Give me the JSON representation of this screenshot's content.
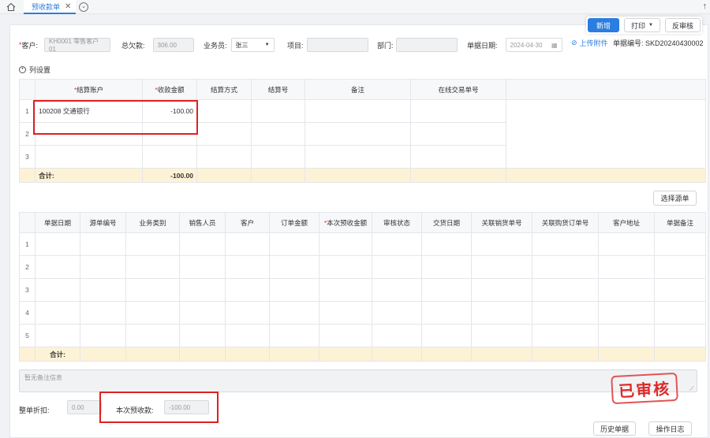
{
  "tabs": {
    "active": "预收款单",
    "close": "✕"
  },
  "toolbar": {
    "new": "新增",
    "print": "打印",
    "unaudit": "反审核"
  },
  "form": {
    "customer_label": "客户:",
    "customer_value": "KH0001 零售客户01",
    "debt_label": "总欠款:",
    "debt_value": "306.00",
    "sales_label": "业务员:",
    "sales_value": "张三",
    "project_label": "项目:",
    "dept_label": "部门:",
    "date_label": "单据日期:",
    "date_value": "2024-04-30",
    "upload": "上传附件",
    "docno": "单据编号: SKD20240430002"
  },
  "colset": "列设置",
  "settle_table": {
    "headers": [
      "结算账户",
      "收款金额",
      "结算方式",
      "结算号",
      "备注",
      "在线交易单号"
    ],
    "rows": [
      {
        "no": "1",
        "account": "100208 交通银行",
        "amount": "-100.00"
      },
      {
        "no": "2",
        "account": "",
        "amount": ""
      },
      {
        "no": "3",
        "account": "",
        "amount": ""
      }
    ],
    "sum_label": "合计:",
    "sum_amount": "-100.00"
  },
  "select_source": "选择源单",
  "source_table": {
    "headers": [
      "单据日期",
      "源单编号",
      "业务类别",
      "销售人员",
      "客户",
      "订单金额",
      "本次预收金额",
      "审核状态",
      "交货日期",
      "关联销货单号",
      "关联购货订单号",
      "客户地址",
      "单据备注"
    ],
    "rows": [
      "1",
      "2",
      "3",
      "4",
      "5"
    ],
    "sum_label": "合计:"
  },
  "remark_placeholder": "暂无备注信息",
  "stamp": "已审核",
  "bottom": {
    "discount_label": "整单折扣:",
    "discount_value": "0.00",
    "prepay_label": "本次预收款:",
    "prepay_value": "-100.00",
    "history": "历史单据",
    "log": "操作日志"
  },
  "colors": {
    "accent": "#2a7de1",
    "highlight": "#e02020",
    "sum_row": "#fdf2d6"
  }
}
